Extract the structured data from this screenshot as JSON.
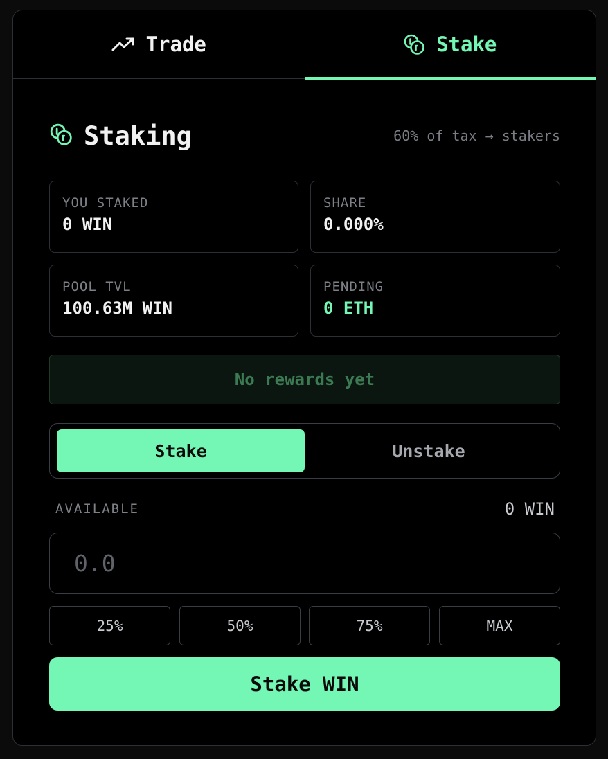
{
  "tabs": [
    {
      "label": "Trade",
      "icon": "trending-up-icon",
      "active": false
    },
    {
      "label": "Stake",
      "icon": "coins-icon",
      "active": true
    }
  ],
  "staking": {
    "title": "Staking",
    "icon": "coins-icon",
    "subtitle": "60% of tax → stakers"
  },
  "stats": {
    "you_staked": {
      "label": "YOU STAKED",
      "value": "0 WIN"
    },
    "share": {
      "label": "SHARE",
      "value": "0.000%"
    },
    "pool_tvl": {
      "label": "POOL TVL",
      "value": "100.63M WIN"
    },
    "pending": {
      "label": "PENDING",
      "value": "0 ETH"
    }
  },
  "rewards": {
    "text": "No rewards yet"
  },
  "mode_toggle": {
    "stake_label": "Stake",
    "unstake_label": "Unstake",
    "selected": "Stake"
  },
  "available": {
    "label": "AVAILABLE",
    "value": "0 WIN"
  },
  "amount_input": {
    "placeholder": "0.0",
    "value": ""
  },
  "percent_buttons": [
    "25%",
    "50%",
    "75%",
    "MAX"
  ],
  "submit": {
    "label": "Stake WIN"
  },
  "colors": {
    "accent": "#74f7b4",
    "background": "#000000",
    "border": "#2c2f36"
  }
}
